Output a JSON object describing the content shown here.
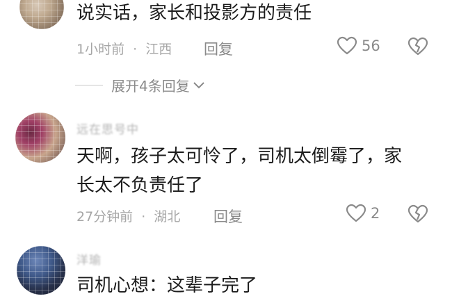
{
  "comments": [
    {
      "text": "说实话，家长和投影方的责任",
      "time": "1小时前",
      "location": "江西",
      "reply_label": "回复",
      "likes": "56"
    },
    {
      "nickname": "远在思号中",
      "text_line1": "天啊，孩子太可怜了，司机太倒霉了，家",
      "text_line2": "长太不负责任了",
      "time": "27分钟前",
      "location": "湖北",
      "reply_label": "回复",
      "likes": "2"
    },
    {
      "nickname": "洋瑜",
      "text": "司机心想：这辈子完了"
    }
  ],
  "expand_replies": "展开4条回复",
  "separator": "·",
  "colors": {
    "background": "#ffffff",
    "text": "#1c1c1c",
    "meta": "#a6a6a6",
    "icon": "#8a8a8a"
  }
}
